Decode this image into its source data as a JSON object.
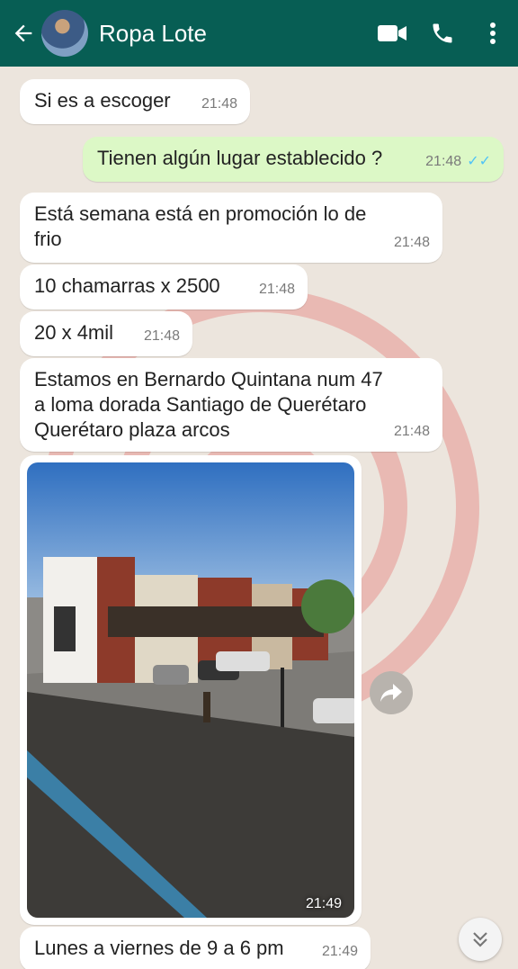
{
  "header": {
    "title": "Ropa Lote"
  },
  "messages": [
    {
      "text": "Si es a escoger",
      "time": "21:48"
    },
    {
      "text": "Tienen algún lugar establecido ?",
      "time": "21:48",
      "ticks": "✓✓"
    },
    {
      "line1": "Está semana está en promoción lo de",
      "line2": "frio",
      "time": "21:48"
    },
    {
      "text": "10 chamarras x 2500",
      "time": "21:48"
    },
    {
      "text": "20 x 4mil",
      "time": "21:48"
    },
    {
      "line1": "Estamos en Bernardo Quintana num 47",
      "line2": "a loma dorada Santiago de Querétaro",
      "line3": "Querétaro plaza arcos",
      "time": "21:48"
    },
    {
      "image_time": "21:49"
    },
    {
      "text": "Lunes a viernes de 9 a 6 pm",
      "time": "21:49"
    }
  ],
  "colors": {
    "header": "#075e54",
    "outgoing": "#dcf8c6",
    "incoming": "#ffffff",
    "read_ticks": "#4fc3f7",
    "background": "#ece5dd"
  },
  "icons": [
    "back-arrow-icon",
    "video-call-icon",
    "phone-icon",
    "more-options-icon",
    "forward-icon",
    "scroll-down-icon"
  ]
}
